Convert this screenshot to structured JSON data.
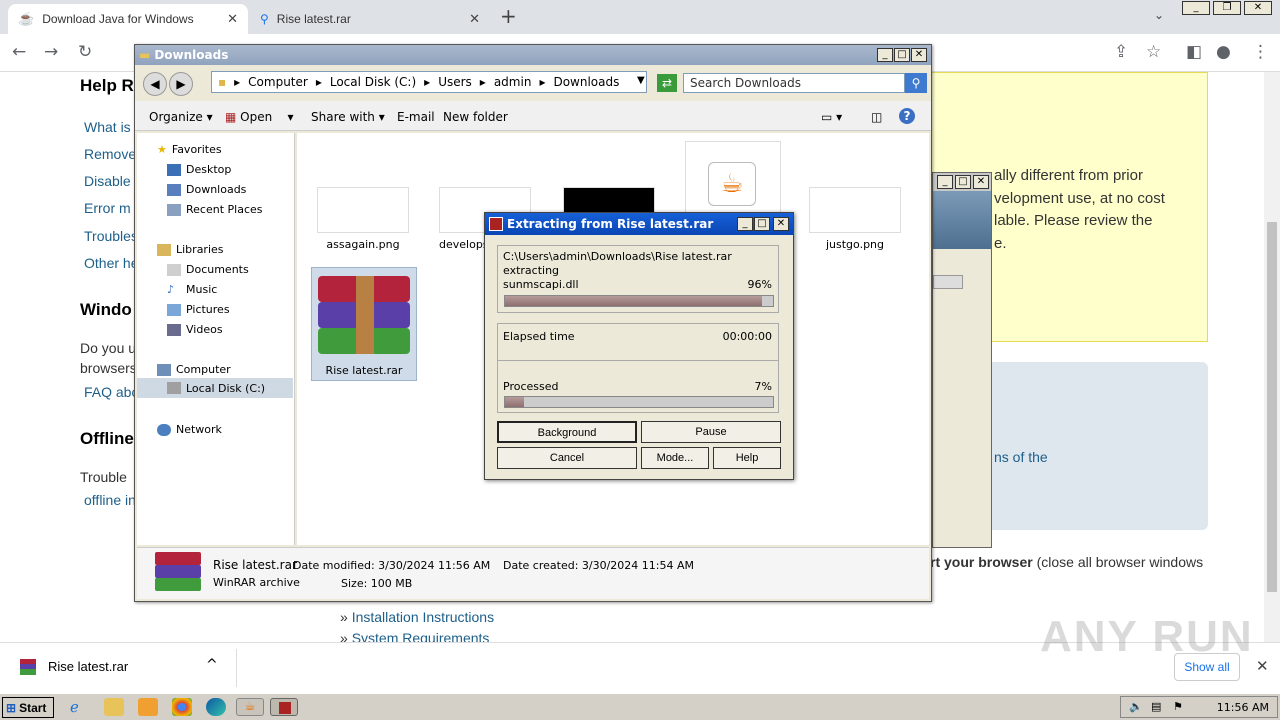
{
  "browser": {
    "tabs": [
      {
        "label": "Download Java for Windows"
      },
      {
        "label": "Rise latest.rar"
      }
    ],
    "new_tab": "+"
  },
  "webpage": {
    "help_heading": "Help R",
    "help_links": [
      "What is",
      "Remove",
      "Disable",
      "Error m",
      "Troubles",
      "Other he"
    ],
    "windows_heading": "Windo",
    "windows_text": [
      "Do you u",
      "browsers"
    ],
    "faq_link": "FAQ abo",
    "offline_heading": "Offline",
    "offline_text": "Trouble",
    "offline_link": "offline in",
    "yellow_lines": [
      "ally different from prior",
      "velopment use, at no cost",
      "lable. Please review the",
      "e."
    ],
    "blue_link": "ns of the",
    "restart_bold": "rt your browser",
    "restart_rest": " (close all browser windows",
    "install_link": "Installation Instructions",
    "sysreq_link": "System Requirements",
    "bullet": "»"
  },
  "explorer": {
    "title": "Downloads",
    "breadcrumb": [
      "Computer",
      "Local Disk (C:)",
      "Users",
      "admin",
      "Downloads"
    ],
    "search_placeholder": "Search Downloads",
    "commands": {
      "organize": "Organize",
      "open": "Open",
      "share": "Share with",
      "email": "E-mail",
      "newfolder": "New folder"
    },
    "nav": {
      "favorites": "Favorites",
      "desktop": "Desktop",
      "downloads": "Downloads",
      "recent": "Recent Places",
      "libraries": "Libraries",
      "documents": "Documents",
      "music": "Music",
      "pictures": "Pictures",
      "videos": "Videos",
      "computer": "Computer",
      "localdisk": "Local Disk (C:)",
      "network": "Network"
    },
    "files": {
      "f1": "assagain.png",
      "f2": "develops",
      "f3": "justgo.png",
      "f4": "Rise latest.rar"
    },
    "details": {
      "name": "Rise latest.rar",
      "type": "WinRAR archive",
      "modified": "Date modified: 3/30/2024 11:56 AM",
      "size": "Size: 100 MB",
      "created": "Date created: 3/30/2024 11:54 AM"
    }
  },
  "dialog": {
    "title": "Extracting from Rise latest.rar",
    "path": "C:\\Users\\admin\\Downloads\\Rise latest.rar",
    "status": "extracting",
    "file": "sunmscapi.dll",
    "file_percent": "96%",
    "file_progress": 0.96,
    "elapsed_label": "Elapsed time",
    "elapsed_value": "00:00:00",
    "processed_label": "Processed",
    "processed_percent": "7%",
    "processed_progress": 0.07,
    "buttons": {
      "background": "Background",
      "pause": "Pause",
      "cancel": "Cancel",
      "mode": "Mode...",
      "help": "Help"
    }
  },
  "downloads_bar": {
    "item": "Rise latest.rar",
    "show_all": "Show all"
  },
  "taskbar": {
    "start": "Start",
    "clock": "11:56 AM"
  },
  "watermark": "ANY RUN"
}
